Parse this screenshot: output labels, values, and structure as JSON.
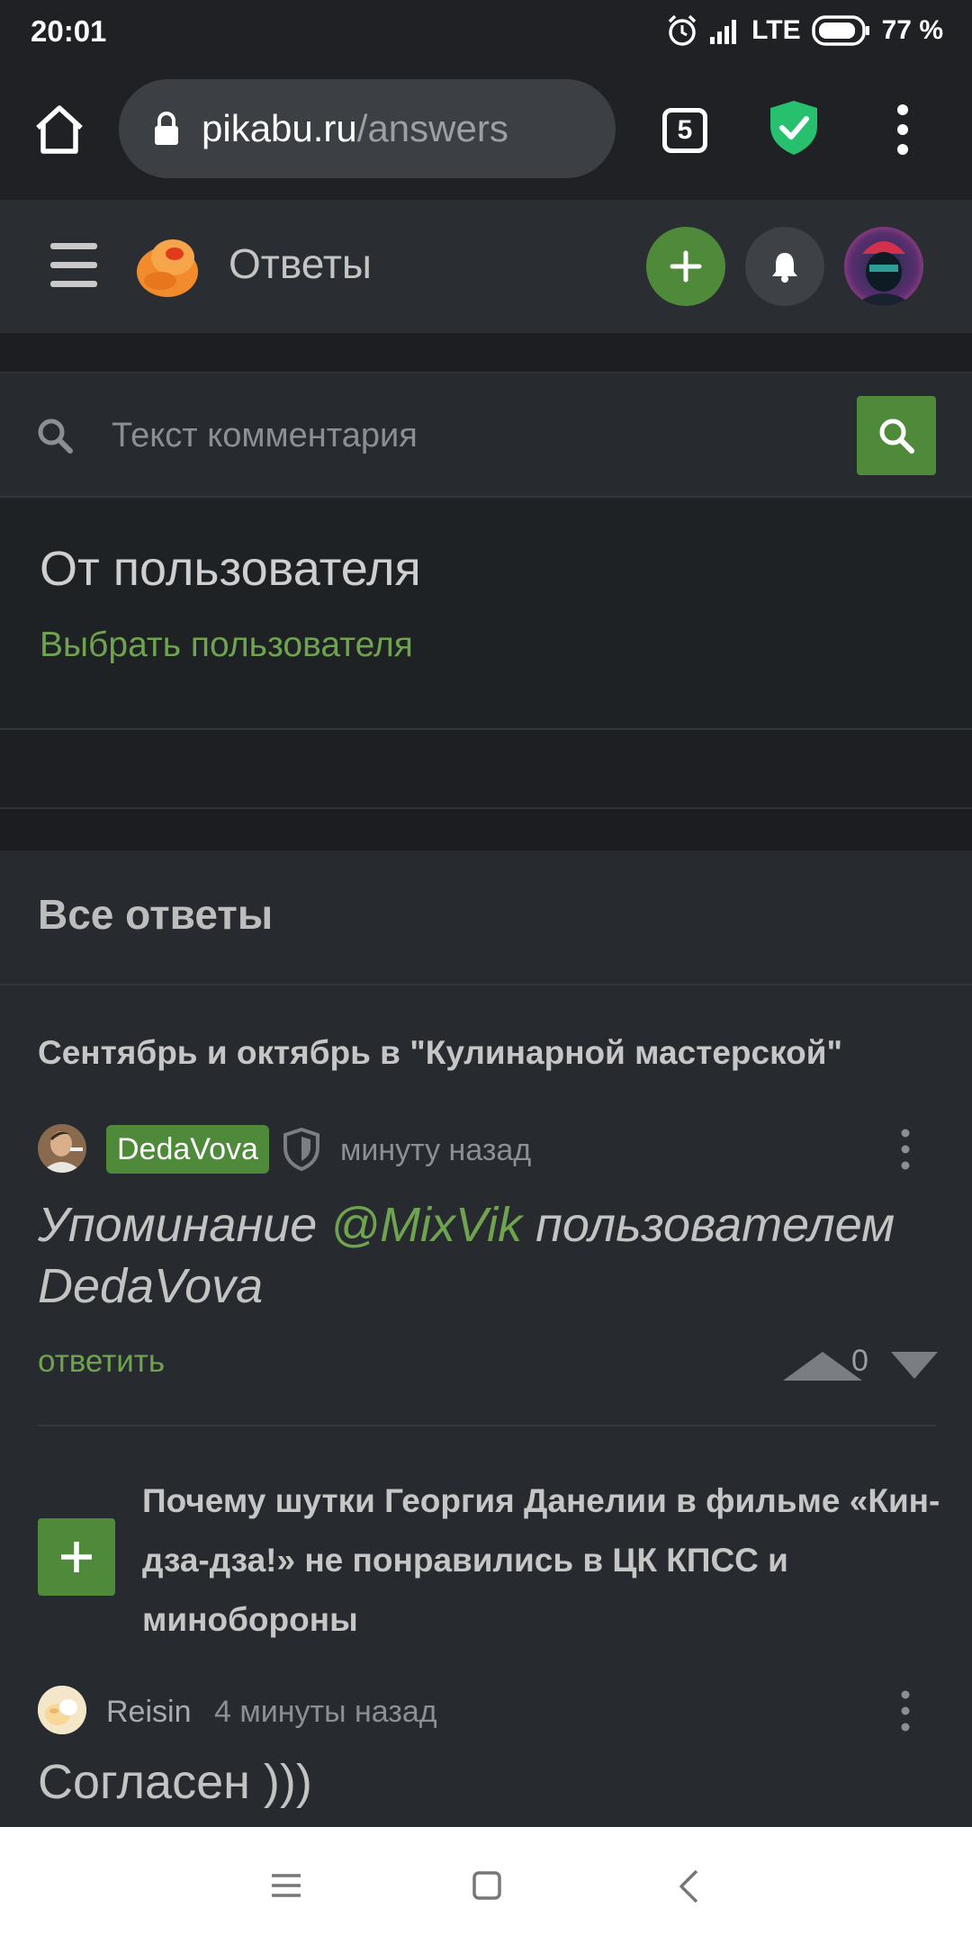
{
  "status_bar": {
    "time": "20:01",
    "network": "LTE",
    "battery": "77 %"
  },
  "browser": {
    "url_host": "pikabu.ru",
    "url_path": "/answers",
    "tab_count": "5"
  },
  "header": {
    "title": "Ответы"
  },
  "search": {
    "placeholder": "Текст комментария"
  },
  "from_user": {
    "title": "От пользователя",
    "choose_link": "Выбрать пользователя"
  },
  "answers": {
    "section_title": "Все ответы",
    "items": [
      {
        "post_title": "Сентябрь и октябрь в \"Кулинарной мастерской\"",
        "author": "DedaVova",
        "time": "минуту назад",
        "text_prefix": "Упоминание ",
        "mention": "@MixVik",
        "text_suffix": " пользователем DedaVova",
        "reply_label": "ответить",
        "rating": "0"
      },
      {
        "post_title": "Почему шутки Георгия Данелии в фильме «Кин-дза-дза!» не понравились в ЦК КПСС и минобороны",
        "author": "Reisin",
        "time": "4 минуты назад",
        "text": "Согласен )))"
      }
    ]
  },
  "colors": {
    "accent_green": "#4f8a3b",
    "link_green": "#6fa34f",
    "background": "#272a2e"
  }
}
